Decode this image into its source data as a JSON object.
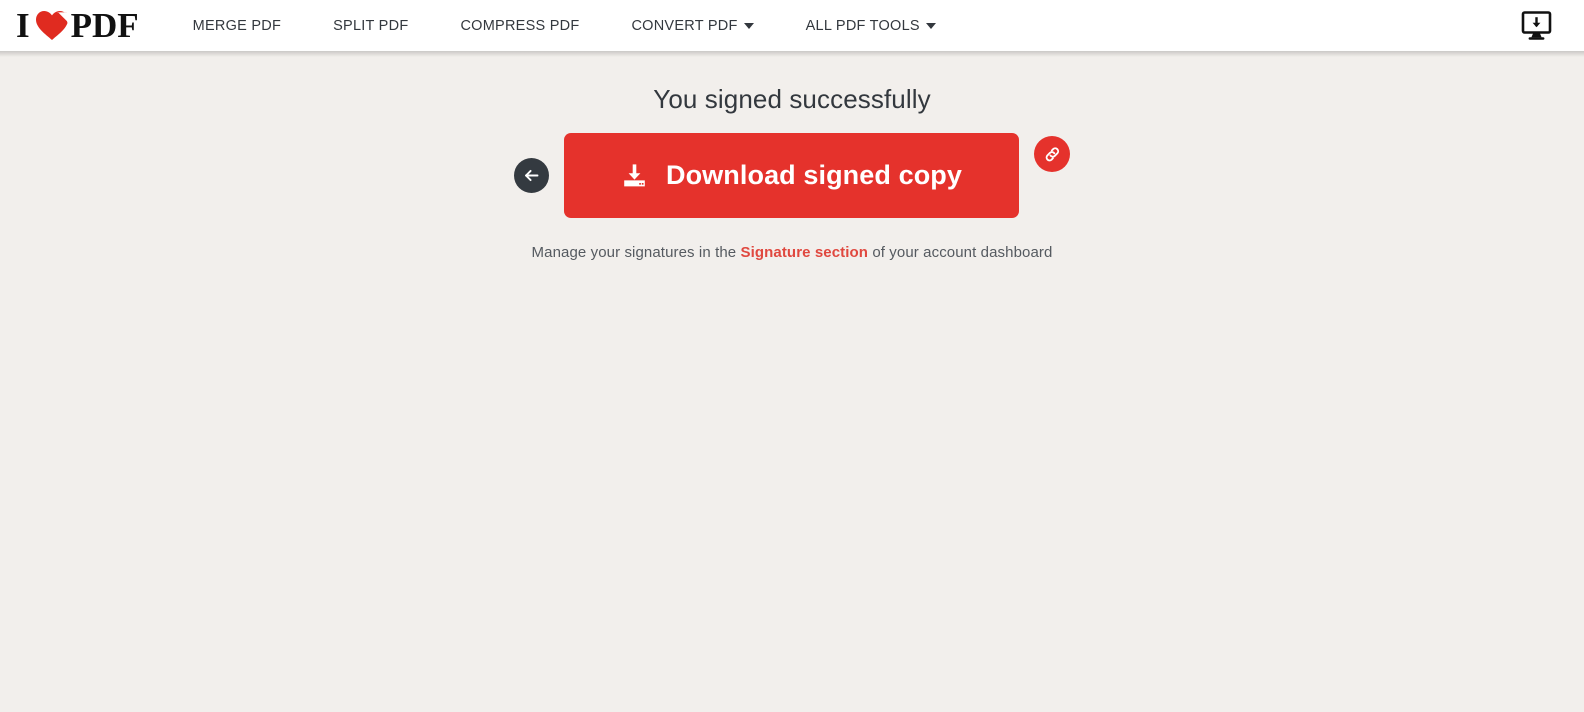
{
  "colors": {
    "page_bg": "#f2efec",
    "header_bg": "#ffffff",
    "brand_red": "#e5322c",
    "link_red": "#e0483f",
    "dark": "#343a40",
    "text": "#33383e"
  },
  "header": {
    "logo": {
      "text_left": "I",
      "text_right": "PDF",
      "heart_icon": "heart-page-fold-icon",
      "alt": "I LOVE PDF"
    },
    "nav": [
      {
        "label": "MERGE PDF",
        "has_caret": false
      },
      {
        "label": "SPLIT PDF",
        "has_caret": false
      },
      {
        "label": "COMPRESS PDF",
        "has_caret": false
      },
      {
        "label": "CONVERT PDF",
        "has_caret": true
      },
      {
        "label": "ALL PDF TOOLS",
        "has_caret": true
      }
    ],
    "desktop_app_icon": "desktop-download-icon"
  },
  "main": {
    "title": "You signed successfully",
    "back_button": {
      "icon": "arrow-left-icon",
      "label": "Back"
    },
    "download_button": {
      "label": "Download signed copy",
      "icon": "download-icon"
    },
    "copy_link_button": {
      "icon": "link-chain-icon",
      "label": "Copy link"
    },
    "subtext": {
      "before": "Manage your signatures in the ",
      "link": "Signature section",
      "after": " of your account dashboard"
    }
  }
}
